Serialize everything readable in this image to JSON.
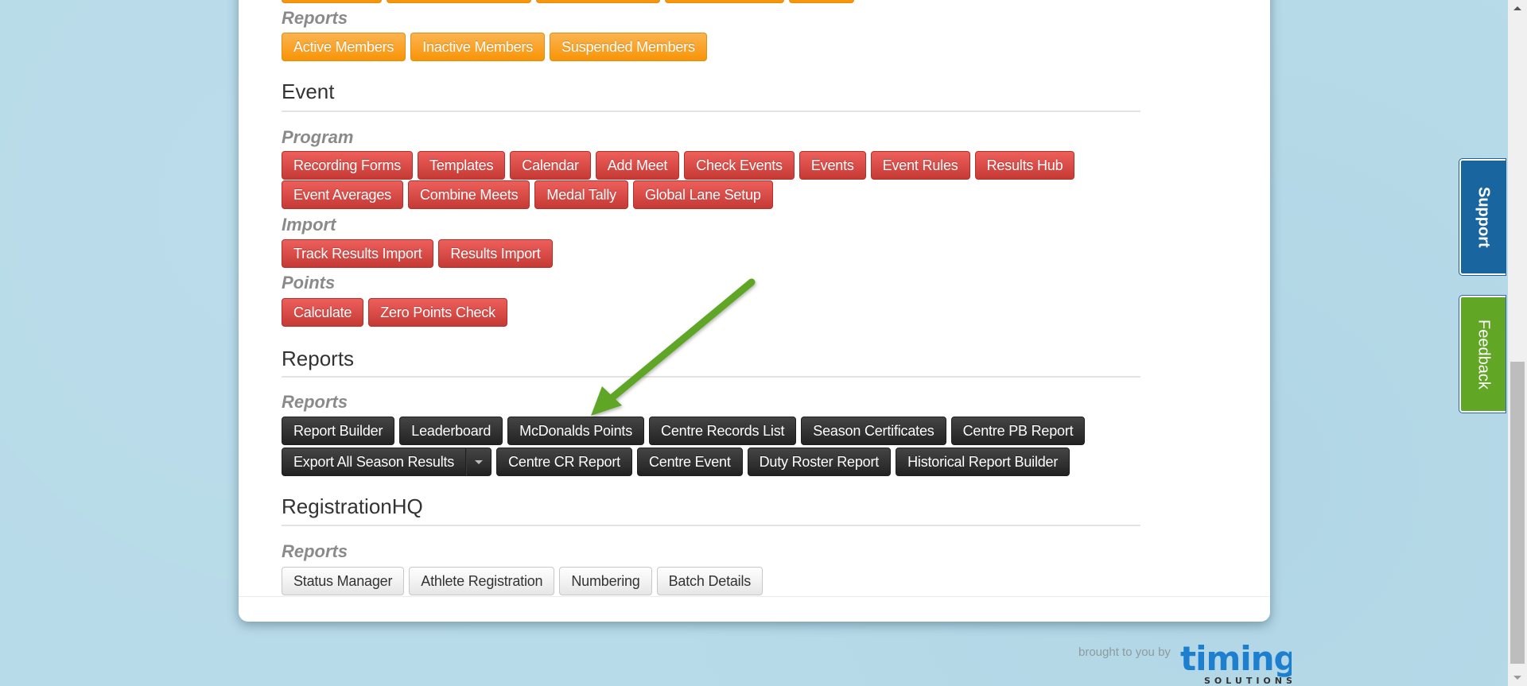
{
  "colors": {
    "background": "#b8dbe9",
    "orange": "#f89406",
    "red": "#c53a35",
    "dark": "#222222",
    "support": "#1865a0",
    "feedback": "#62a626",
    "arrow": "#5ea526"
  },
  "members_section": {
    "partial_row_buttons": 5,
    "reports_label": "Reports",
    "reports_buttons": [
      "Active Members",
      "Inactive Members",
      "Suspended Members"
    ]
  },
  "event_section": {
    "title": "Event",
    "program_label": "Program",
    "program_row1": [
      "Recording Forms",
      "Templates",
      "Calendar",
      "Add Meet",
      "Check Events",
      "Events",
      "Event Rules",
      "Results Hub"
    ],
    "program_row2": [
      "Event Averages",
      "Combine Meets",
      "Medal Tally",
      "Global Lane Setup"
    ],
    "import_label": "Import",
    "import_buttons": [
      "Track Results Import",
      "Results Import"
    ],
    "points_label": "Points",
    "points_buttons": [
      "Calculate",
      "Zero Points Check"
    ]
  },
  "reports_section": {
    "title": "Reports",
    "reports_label": "Reports",
    "row1": [
      "Report Builder",
      "Leaderboard",
      "McDonalds Points",
      "Centre Records List",
      "Season Certificates",
      "Centre PB Report"
    ],
    "export_split_button": "Export All Season Results",
    "row2": [
      "Centre CR Report",
      "Centre Event",
      "Duty Roster Report",
      "Historical Report Builder"
    ]
  },
  "registration_section": {
    "title": "RegistrationHQ",
    "reports_label": "Reports",
    "buttons": [
      "Status Manager",
      "Athlete Registration",
      "Numbering",
      "Batch Details"
    ]
  },
  "side_tabs": {
    "support": "Support",
    "feedback": "Feedback"
  },
  "footer": {
    "credit": "brought to you by",
    "logo_main": "timing",
    "logo_sub": "SOLUTIONS"
  },
  "annotation": {
    "type": "arrow",
    "points_to": "McDonalds Points"
  }
}
